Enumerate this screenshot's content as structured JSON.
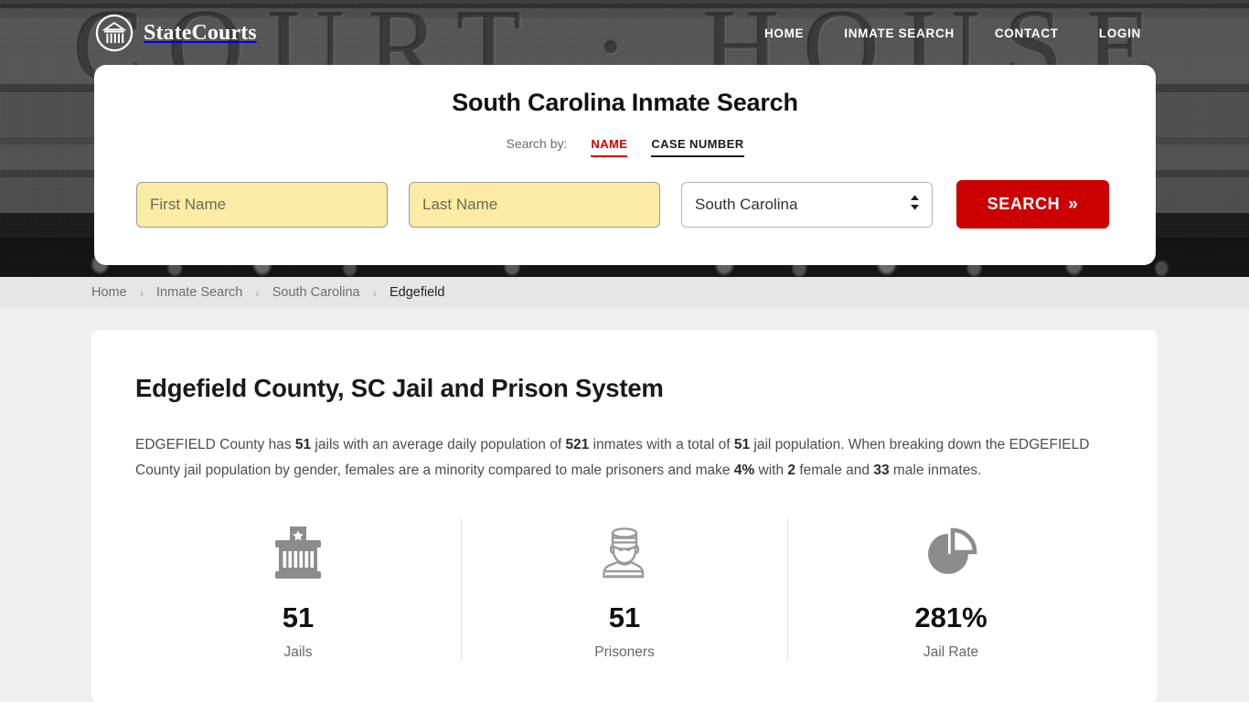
{
  "header": {
    "brand_name": "StateCourts",
    "brand_icon": "courthouse-logo-icon",
    "background_engraving": "COURT · HOUSE",
    "nav": [
      {
        "label": "HOME"
      },
      {
        "label": "INMATE SEARCH"
      },
      {
        "label": "CONTACT"
      },
      {
        "label": "LOGIN"
      }
    ]
  },
  "search": {
    "title": "South Carolina Inmate Search",
    "search_by_label": "Search by:",
    "tabs": [
      {
        "label": "NAME",
        "active": true
      },
      {
        "label": "CASE NUMBER",
        "active": false
      }
    ],
    "first_name_placeholder": "First Name",
    "first_name_value": "",
    "last_name_placeholder": "Last Name",
    "last_name_value": "",
    "state_selected": "South Carolina",
    "state_options": [
      "South Carolina"
    ],
    "submit_label": "SEARCH",
    "submit_chevron": "»",
    "accent_color": "#cc0000",
    "field_fill_color": "#fceba4"
  },
  "breadcrumb": {
    "items": [
      {
        "label": "Home",
        "current": false
      },
      {
        "label": "Inmate Search",
        "current": false
      },
      {
        "label": "South Carolina",
        "current": false
      },
      {
        "label": "Edgefield",
        "current": true
      }
    ],
    "separator": "›"
  },
  "main": {
    "page_title": "Edgefield County, SC Jail and Prison System",
    "summary": {
      "part1": "EDGEFIELD County has ",
      "jails": "51",
      "part2": " jails with an average daily population of ",
      "adp": "521",
      "part3": " inmates with a total of ",
      "total": "51",
      "part4": " jail population. When breaking down the EDGEFIELD County jail population by gender, females are a minority compared to male prisoners and make ",
      "female_pct": "4%",
      "part5": " with ",
      "female_count": "2",
      "part6": " female and ",
      "male_count": "33",
      "part7": " male inmates."
    },
    "stats": [
      {
        "icon": "jail-bars-icon",
        "value": "51",
        "label": "Jails"
      },
      {
        "icon": "prisoner-icon",
        "value": "51",
        "label": "Prisoners"
      },
      {
        "icon": "pie-chart-icon",
        "value": "281%",
        "label": "Jail Rate"
      }
    ]
  }
}
